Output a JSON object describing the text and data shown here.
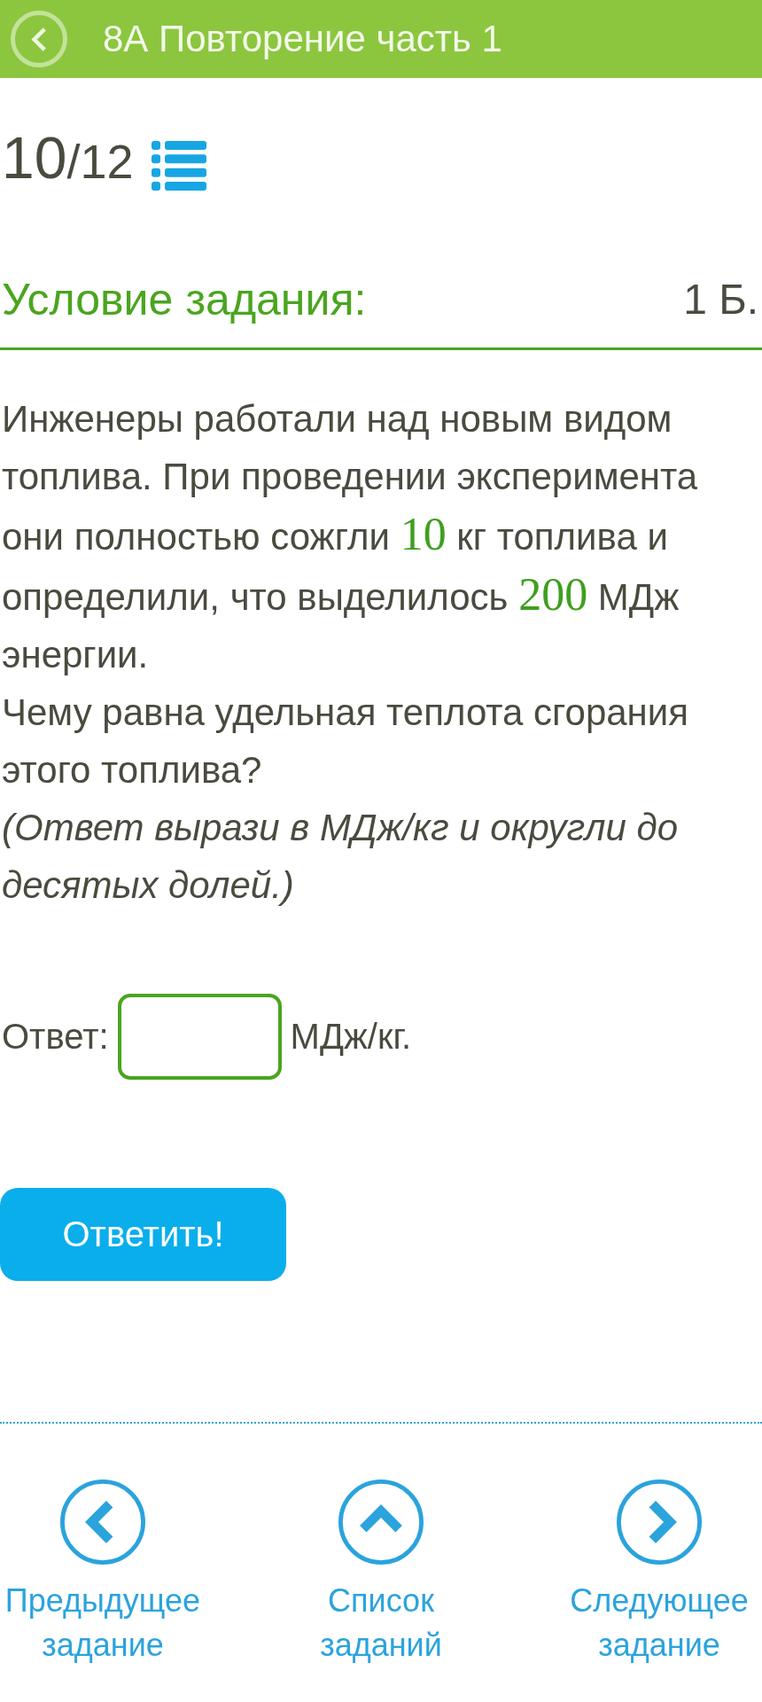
{
  "header": {
    "title": "8А Повторение часть 1"
  },
  "progress": {
    "current": "10",
    "total": "/12"
  },
  "task": {
    "heading": "Условие задания:",
    "points": "1 Б."
  },
  "problem": [
    {
      "kind": "statement",
      "segments": [
        {
          "kind": "text",
          "text": "Инженеры работали над новым видом топлива. При проведении эксперимента они полностью сожгли "
        },
        {
          "kind": "math",
          "text": "10"
        },
        {
          "kind": "text",
          "text": " кг топлива и определили, что выделилось "
        },
        {
          "kind": "math",
          "text": "200"
        },
        {
          "kind": "text",
          "text": " МДж энергии."
        }
      ]
    },
    {
      "kind": "question",
      "segments": [
        {
          "kind": "text",
          "text": "Чему равна удельная теплота сгорания этого топлива?"
        }
      ]
    },
    {
      "kind": "note",
      "segments": [
        {
          "kind": "text",
          "text": "(Ответ вырази в МДж/кг и округли до десятых долей.)"
        }
      ]
    }
  ],
  "answer": {
    "label": "Ответ:",
    "unit": "МДж/кг."
  },
  "submit": {
    "label": "Ответить!"
  },
  "nav": [
    {
      "kind": "prev",
      "label": "Предыдущее задание"
    },
    {
      "kind": "list",
      "label": "Список заданий"
    },
    {
      "kind": "next",
      "label": "Следующее задание"
    }
  ]
}
